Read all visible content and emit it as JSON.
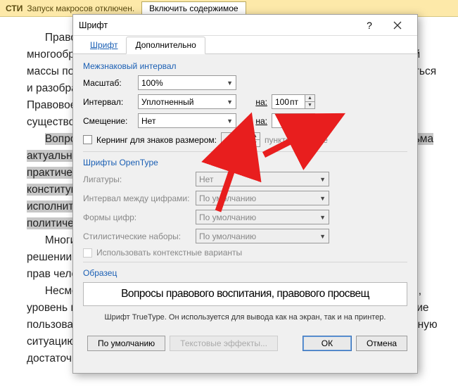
{
  "security_bar": {
    "label": "СТИ",
    "text": "Запуск макросов отключен.",
    "enable_btn": "Включить содержимое"
  },
  "document": {
    "text_html": "&nbsp;&nbsp;&nbsp;&nbsp;&nbsp;&nbsp;Правово-парадигма и нормативная система государства функционирует многообразием правовых актов и подчиненных им источников. Для огромной массы подзаконных актов и инструкций невозможно в полном объеме изучиться и разобраться, но именно они составляют правовую основу.<br>Правовое государство строится на принципах верховенства закона и существования элементарных правил и норм.<br>&nbsp;&nbsp;&nbsp;&nbsp;&nbsp;&nbsp;<span class='highlight'>Вопросы правового воспитания и правовой культуры стали весьма и весьма актуальными в свете многочисленных изменений и дополнений в состав практической жизни. Наша страна переживает период реформирования конституционных основ, разделения законодательной, судебной и исполнительной власти, что требует от граждан высокой правовой, политической и информационной культуры.</span><br>&nbsp;&nbsp;&nbsp;&nbsp;&nbsp;&nbsp;Многие современные проблемы требуют активного взаимодействия в решении вопросов правового воспитания, правового просвещения и защиты прав человека на разных уровнях образования и обучения.<br>&nbsp;&nbsp;&nbsp;&nbsp;&nbsp;&nbsp;Несмотря на многочисленные усилия по развитию основ правовой жизни, уровень правовой культуры населения оставляет желать еще лучшего: умение пользоваться правом, знание законов, способность предотвратить конфликтную ситуацию — все это становится необходимым. Уровень правовой культуры достаточно высок, но не так как хотелось бы. Право формирует"
  },
  "dialog": {
    "title": "Шрифт",
    "tabs": {
      "font": "Шрифт",
      "advanced": "Дополнительно"
    },
    "spacing": {
      "group": "Межзнаковый интервал",
      "scale_label": "Масштаб:",
      "scale_value": "100%",
      "interval_label": "Интервал:",
      "interval_value": "Уплотненный",
      "by_label": "на:",
      "by_value": "100",
      "by_unit": "пт",
      "position_label": "Смещение:",
      "position_value": "Нет",
      "position_by_label": "на:",
      "kerning_label": "Кернинг для знаков размером:",
      "kerning_unit": "пунктов и более"
    },
    "opentype": {
      "group": "Шрифты OpenType",
      "ligatures_label": "Лигатуры:",
      "ligatures_value": "Нет",
      "numspacing_label": "Интервал между цифрами:",
      "numspacing_value": "По умолчанию",
      "numforms_label": "Формы цифр:",
      "numforms_value": "По умолчанию",
      "stylesets_label": "Стилистические наборы:",
      "stylesets_value": "По умолчанию",
      "contextual_label": "Использовать контекстные варианты"
    },
    "preview": {
      "group": "Образец",
      "text": "Вопросы правового воспитания, правового просвещ",
      "note": "Шрифт TrueType. Он используется для вывода как на экран, так и на принтер."
    },
    "buttons": {
      "default": "По умолчанию",
      "effects": "Текстовые эффекты...",
      "ok": "ОК",
      "cancel": "Отмена"
    }
  }
}
